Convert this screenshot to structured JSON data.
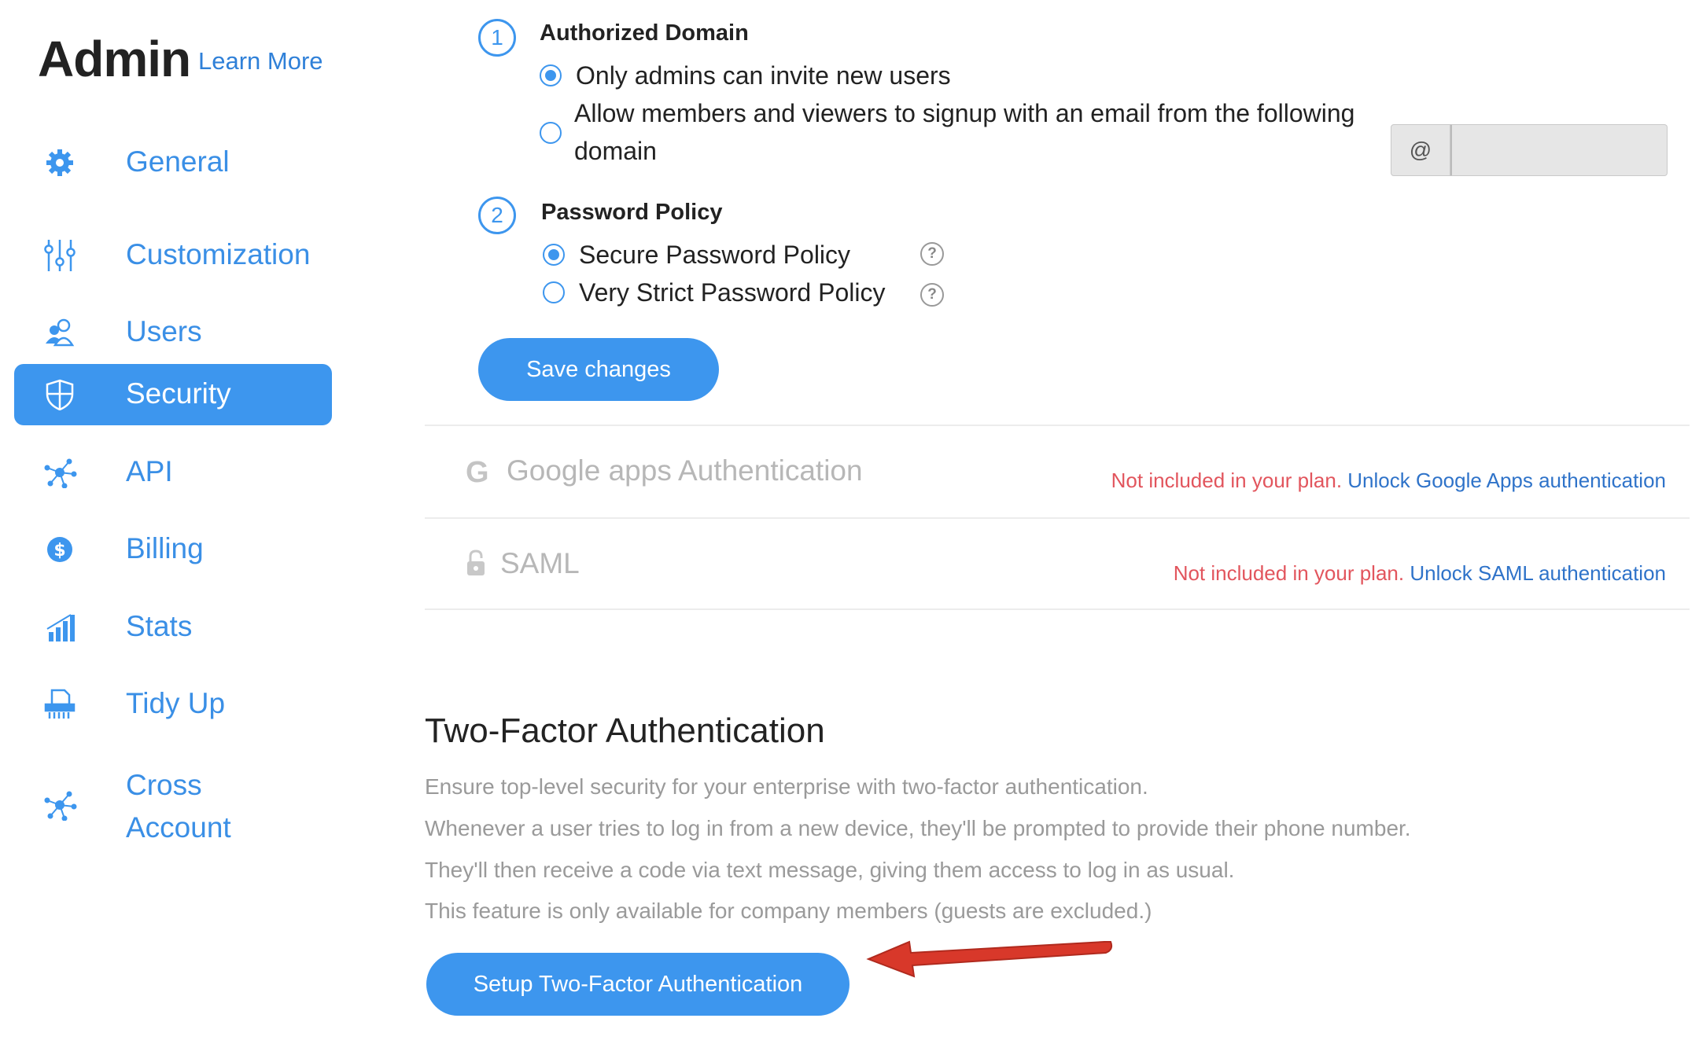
{
  "sidebar": {
    "title": "Admin",
    "learn_more": "Learn More",
    "items": [
      {
        "label": "General",
        "icon": "gear-icon"
      },
      {
        "label": "Customization",
        "icon": "sliders-icon"
      },
      {
        "label": "Users",
        "icon": "users-icon"
      },
      {
        "label": "Security",
        "icon": "shield-icon",
        "active": true
      },
      {
        "label": "API",
        "icon": "network-icon"
      },
      {
        "label": "Billing",
        "icon": "dollar-icon"
      },
      {
        "label": "Stats",
        "icon": "bar-chart-icon"
      },
      {
        "label": "Tidy Up",
        "icon": "shredder-icon"
      },
      {
        "label": "Cross Account",
        "icon": "network-icon"
      }
    ]
  },
  "authorized_domain": {
    "step": "1",
    "title": "Authorized Domain",
    "options": [
      {
        "label": "Only admins can invite new users",
        "checked": true
      },
      {
        "label": "Allow members and viewers to signup with an email from the following domain",
        "checked": false
      }
    ],
    "at_symbol": "@",
    "domain_value": ""
  },
  "password_policy": {
    "step": "2",
    "title": "Password Policy",
    "options": [
      {
        "label": "Secure Password Policy",
        "checked": true
      },
      {
        "label": "Very Strict Password Policy",
        "checked": false
      }
    ],
    "help_glyph": "?"
  },
  "save_button": "Save changes",
  "google_auth": {
    "icon_letter": "G",
    "title": "Google apps Authentication",
    "not_included": "Not included in your plan.",
    "unlock": "Unlock Google Apps authentication"
  },
  "saml": {
    "title": "SAML",
    "not_included": "Not included in your plan.",
    "unlock": "Unlock SAML authentication"
  },
  "two_factor": {
    "heading": "Two-Factor Authentication",
    "lines": [
      "Ensure top-level security for your enterprise with two-factor authentication.",
      "Whenever a user tries to log in from a new device, they'll be prompted to provide their phone number.",
      "They'll then receive a code via text message, giving them access to log in as usual.",
      "This feature is only available for company members (guests are excluded.)"
    ],
    "button": "Setup Two-Factor Authentication"
  },
  "colors": {
    "accent": "#3d96ee",
    "warning": "#e2555d",
    "link": "#2f73c9",
    "arrow": "#d8382a"
  }
}
